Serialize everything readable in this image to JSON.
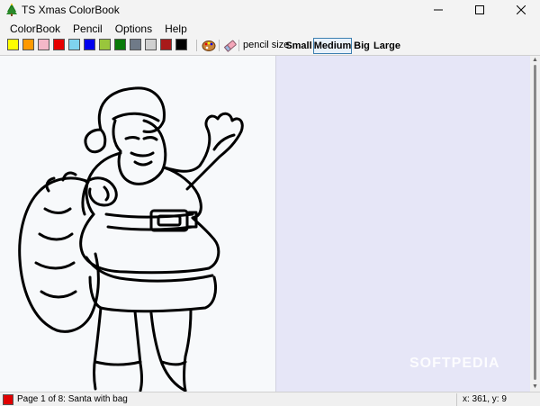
{
  "window": {
    "title": "TS Xmas ColorBook",
    "controls": {
      "minimize": "—",
      "maximize": "☐",
      "close": "✕"
    }
  },
  "menu": {
    "items": [
      "ColorBook",
      "Pencil",
      "Options",
      "Help"
    ]
  },
  "toolbar": {
    "palette": [
      "#ffff00",
      "#ff9900",
      "#f4b8c8",
      "#e60000",
      "#7fd3ee",
      "#0000ee",
      "#99c63c",
      "#0a7a0a",
      "#6f7a88",
      "#d0d0d0",
      "#a81a1a",
      "#000000"
    ],
    "icons": [
      "paint-palette-icon",
      "eraser-icon"
    ],
    "pencil_size_label": "pencil size:",
    "sizes": [
      "Small",
      "Medium",
      "Big",
      "Large"
    ],
    "selected_size": "Medium"
  },
  "canvas": {
    "picture": "Santa with bag",
    "watermark": "SOFTPEDIA"
  },
  "status": {
    "current_color": "#e00000",
    "page_text": "Page 1 of 8: Santa with bag",
    "coords": "x: 361, y: 9"
  }
}
